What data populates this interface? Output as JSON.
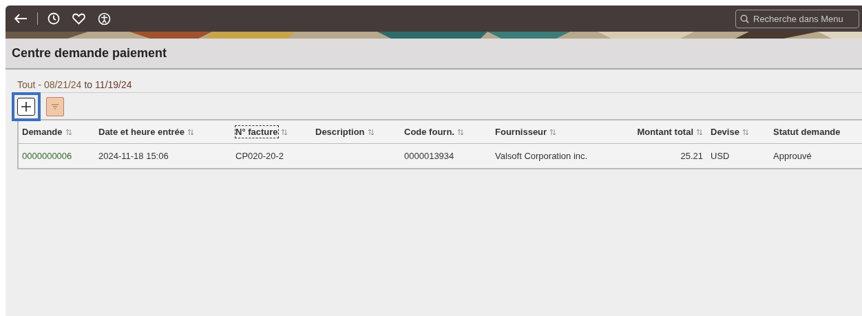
{
  "header": {
    "search": {
      "placeholder": "Recherche dans Menu"
    }
  },
  "page_title": "Centre demande paiement",
  "filter": {
    "label": "Tout - 08/21/24",
    "connector": "to",
    "end": "11/19/24"
  },
  "toolbar": {
    "add_button": {
      "highlighted": true
    },
    "filter_button": {
      "highlighted": false
    }
  },
  "table": {
    "columns": [
      {
        "label": "Demande",
        "kind": "text",
        "focused": false
      },
      {
        "label": "Date et heure entrée",
        "kind": "text",
        "focused": false
      },
      {
        "label": "N° facture",
        "kind": "text",
        "focused": true
      },
      {
        "label": "Description",
        "kind": "text",
        "focused": false
      },
      {
        "label": "Code fourn.",
        "kind": "text",
        "focused": false
      },
      {
        "label": "Fournisseur",
        "kind": "text",
        "focused": false
      },
      {
        "label": "Montant total",
        "kind": "amount",
        "focused": false
      },
      {
        "label": "Devise",
        "kind": "text",
        "focused": false
      },
      {
        "label": "Statut demande",
        "kind": "text",
        "focused": false
      }
    ],
    "rows": [
      {
        "cells": [
          "0000000006",
          "2024-11-18 15:06",
          "CP020-20-2",
          "",
          "0000013934",
          "Valsoft Corporation inc.",
          "25.21",
          "USD",
          "Approuvé"
        ]
      }
    ]
  }
}
